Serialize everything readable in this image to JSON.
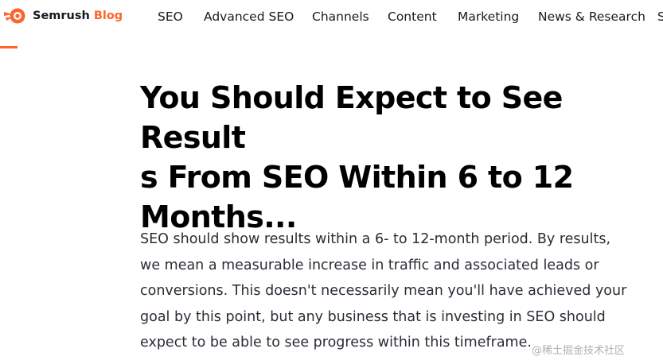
{
  "header": {
    "brand": {
      "name": "Semrush",
      "suffix": "Blog",
      "logo_icon": "semrush-fire-icon",
      "accent": "#ff642d"
    },
    "nav": [
      "SEO",
      "Advanced SEO",
      "Channels",
      "Content",
      "Marketing",
      "News & Research",
      "S"
    ]
  },
  "article": {
    "title_lines": [
      "You Should Expect to See Result",
      "s From SEO Within 6 to 12",
      "Months..."
    ],
    "body_lines": [
      "SEO should show results within a 6- to 12-month period. By results,",
      "we mean a measurable increase in traffic and associated leads or",
      "conversions. This doesn't necessarily mean you'll have achieved your",
      "goal by this point, but any business that is investing in SEO should",
      "expect to be able to see progress within this timeframe."
    ]
  },
  "watermark": "@稀土掘金技术社区"
}
